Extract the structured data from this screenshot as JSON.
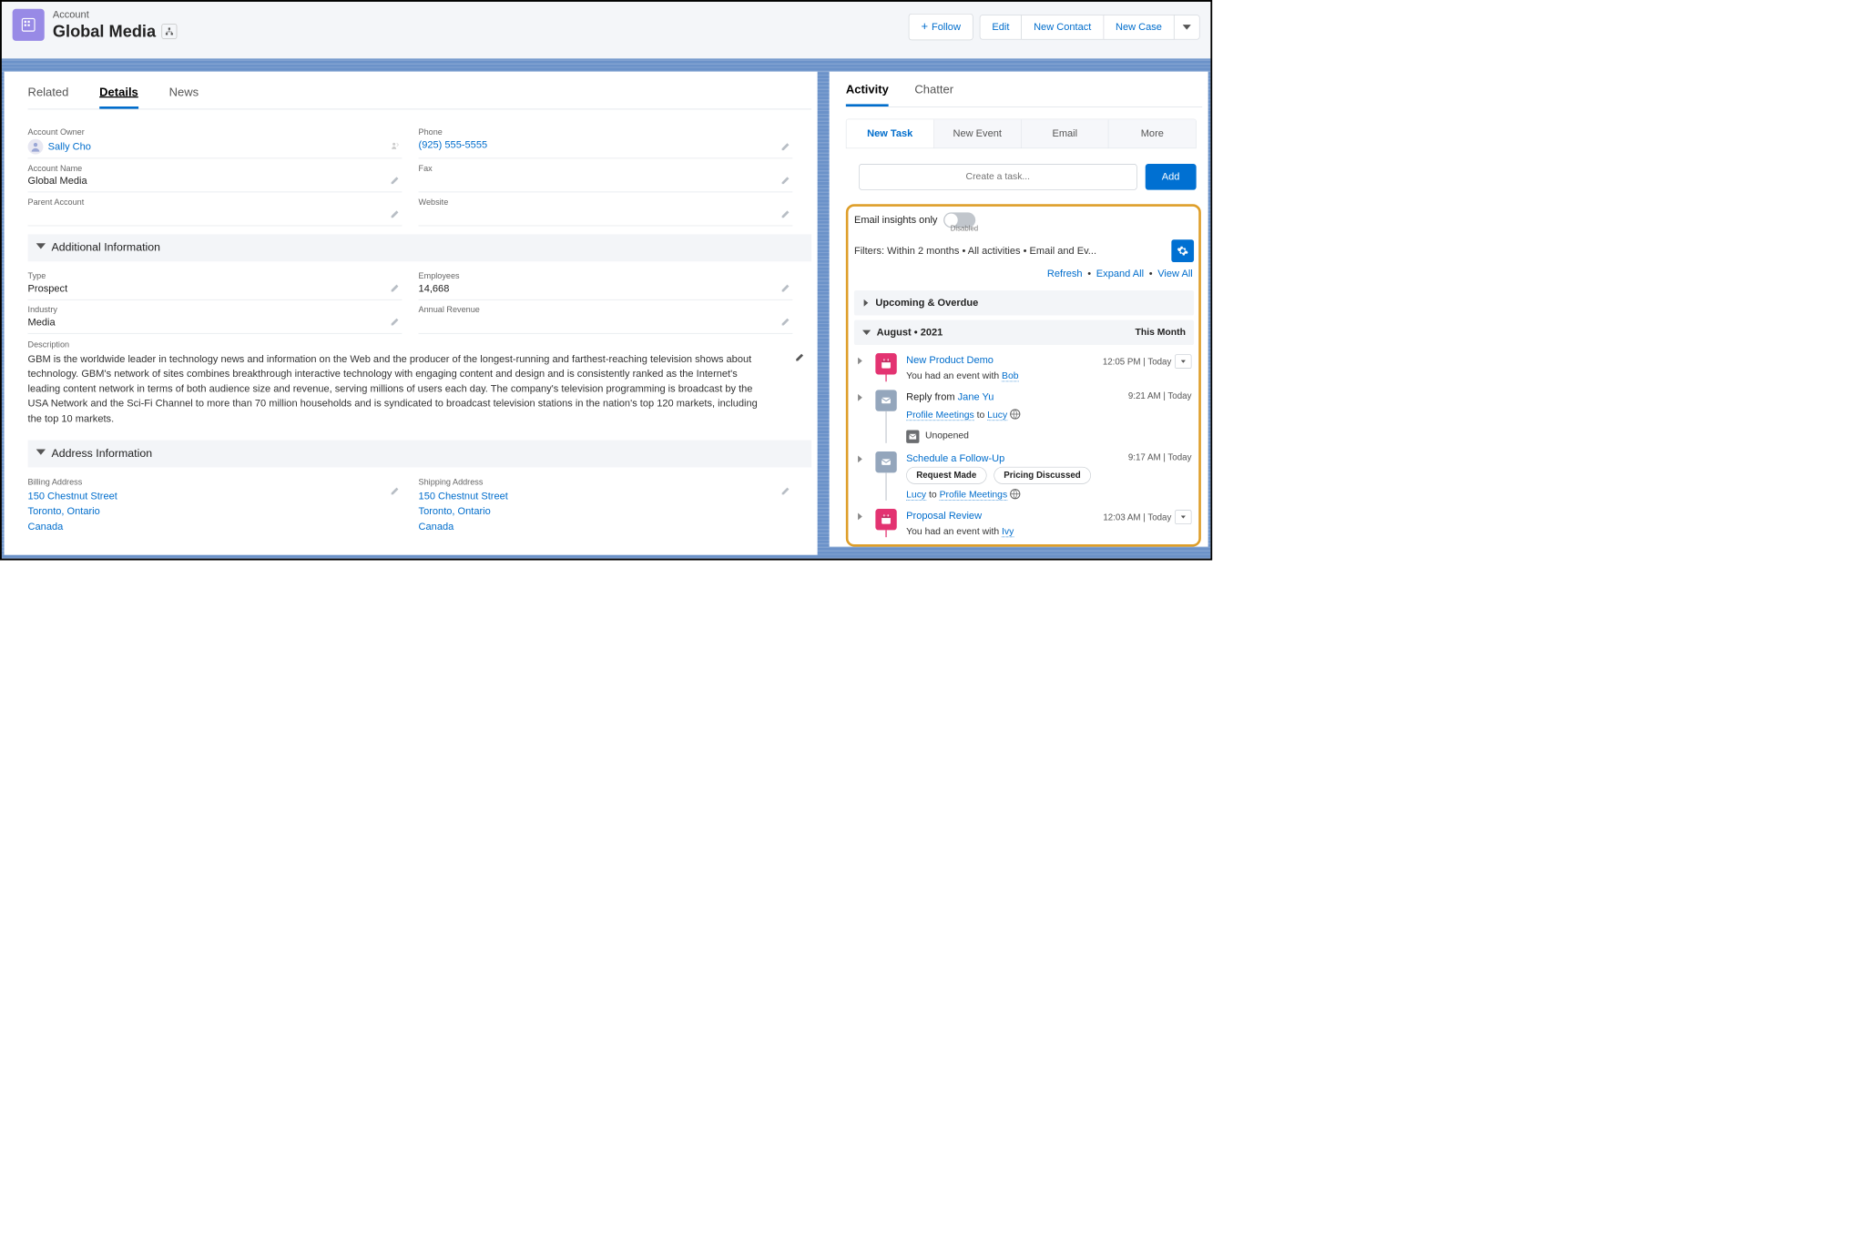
{
  "header": {
    "entity_type": "Account",
    "title": "Global Media",
    "follow": "Follow",
    "edit": "Edit",
    "new_contact": "New Contact",
    "new_case": "New Case"
  },
  "tabs": {
    "related": "Related",
    "details": "Details",
    "news": "News"
  },
  "details": {
    "owner_label": "Account Owner",
    "owner_value": "Sally Cho",
    "phone_label": "Phone",
    "phone_value": "(925) 555-5555",
    "name_label": "Account Name",
    "name_value": "Global Media",
    "fax_label": "Fax",
    "parent_label": "Parent Account",
    "website_label": "Website"
  },
  "additional": {
    "header": "Additional Information",
    "type_label": "Type",
    "type_value": "Prospect",
    "employees_label": "Employees",
    "employees_value": "14,668",
    "industry_label": "Industry",
    "industry_value": "Media",
    "revenue_label": "Annual Revenue",
    "desc_label": "Description",
    "desc_value": "GBM is the worldwide leader in technology news and information on the Web and the producer of the longest-running and farthest-reaching television shows about technology. GBM's network of sites combines breakthrough interactive technology with engaging content and design and is consistently ranked as the Internet's leading content network in terms of both audience size and revenue, serving millions of users each day. The company's television programming is broadcast by the USA Network and the Sci-Fi Channel to more than 70 million households and is syndicated to broadcast television stations in the nation's top 120 markets, including the top 10 markets."
  },
  "address": {
    "header": "Address Information",
    "bill_label": "Billing Address",
    "bill_street": "150 Chestnut Street",
    "bill_city": "Toronto, Ontario",
    "bill_country": "Canada",
    "ship_label": "Shipping Address",
    "ship_street": "150 Chestnut Street",
    "ship_city": "Toronto, Ontario",
    "ship_country": "Canada"
  },
  "side": {
    "tabs": {
      "activity": "Activity",
      "chatter": "Chatter"
    },
    "subtabs": {
      "new_task": "New Task",
      "new_event": "New Event",
      "email": "Email",
      "more": "More"
    },
    "create_placeholder": "Create a task...",
    "add": "Add",
    "insights": "Email insights only",
    "insights_state": "Disabled",
    "filters": "Filters: Within 2 months • All activities • Email and Ev...",
    "links": {
      "refresh": "Refresh",
      "expand": "Expand All",
      "view": "View All"
    },
    "upcoming": "Upcoming & Overdue",
    "month_label": "August  •  2021",
    "month_tag": "This Month"
  },
  "timeline": {
    "i1": {
      "title": "New Product Demo",
      "time": "12:05 PM | Today",
      "desc_pre": "You had an event with ",
      "desc_link": "Bob"
    },
    "i2": {
      "title_pre": "Reply from ",
      "title_link": "Jane Yu",
      "from": "Profile Meetings",
      "to_word": "to",
      "to": "Lucy",
      "time": "9:21 AM | Today",
      "status": "Unopened"
    },
    "i3": {
      "title": "Schedule a Follow-Up",
      "p1": "Request Made",
      "p2": "Pricing Discussed",
      "from": "Lucy",
      "to_word": "to",
      "to": "Profile Meetings",
      "time": "9:17 AM | Today"
    },
    "i4": {
      "title": "Proposal Review",
      "time": "12:03 AM | Today",
      "desc_pre": "You had an event with ",
      "desc_link": "Ivy"
    }
  }
}
